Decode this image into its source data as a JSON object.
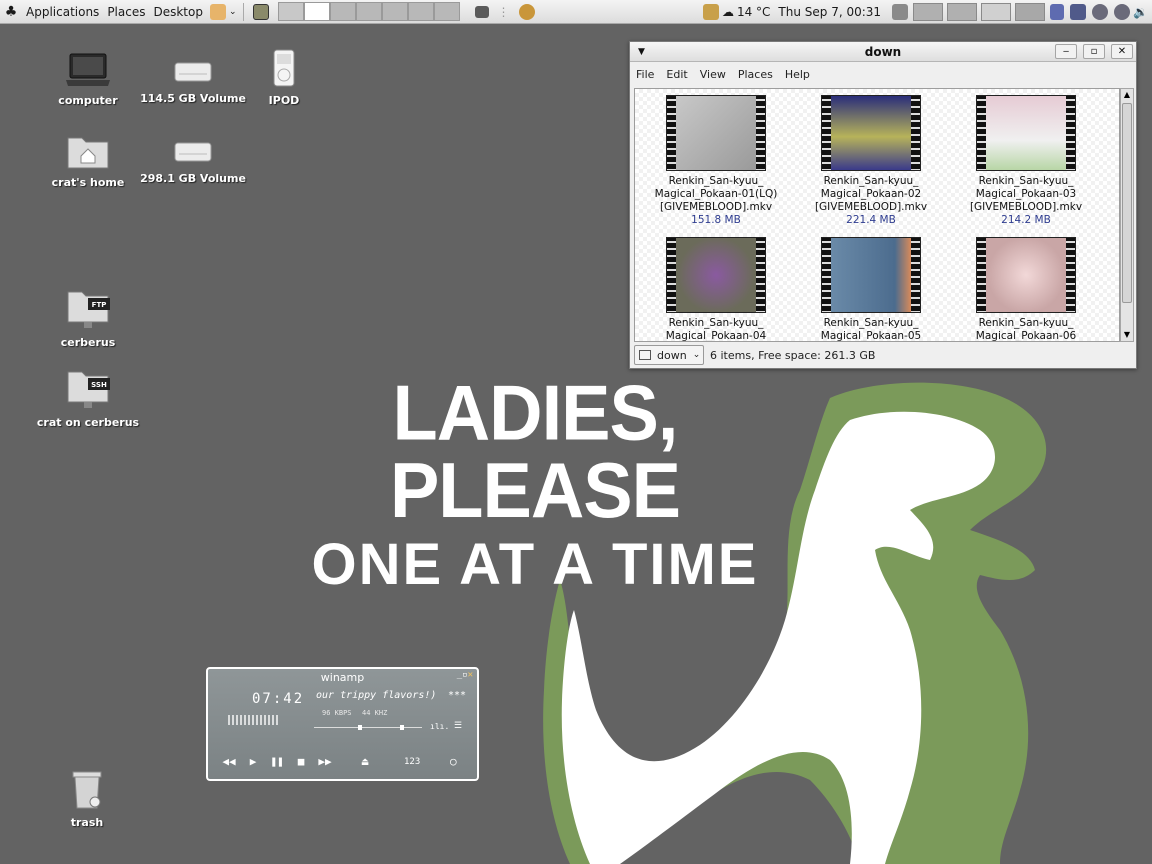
{
  "panel": {
    "menus": [
      "Applications",
      "Places",
      "Desktop"
    ],
    "weather": "14 °C",
    "clock": "Thu Sep  7, 00:31"
  },
  "wallpaper": {
    "line1": "LADIES, PLEASE",
    "line2": "ONE AT A TIME"
  },
  "desktop_icons": [
    {
      "label": "computer"
    },
    {
      "label": "114.5 GB Volume"
    },
    {
      "label": "IPOD"
    },
    {
      "label": "crat's home"
    },
    {
      "label": "298.1 GB Volume"
    },
    {
      "label": "cerberus",
      "badge": "FTP"
    },
    {
      "label": "crat on cerberus",
      "badge": "SSH"
    },
    {
      "label": "trash"
    }
  ],
  "file_manager": {
    "title": "down",
    "menu": [
      "File",
      "Edit",
      "View",
      "Places",
      "Help"
    ],
    "files": [
      {
        "name1": "Renkin_San-kyuu_",
        "name2": "Magical_Pokaan-01(LQ)",
        "name3": "[GIVEMEBLOOD].mkv",
        "size": "151.8 MB"
      },
      {
        "name1": "Renkin_San-kyuu_",
        "name2": "Magical_Pokaan-02",
        "name3": "[GIVEMEBLOOD].mkv",
        "size": "221.4 MB"
      },
      {
        "name1": "Renkin_San-kyuu_",
        "name2": "Magical_Pokaan-03",
        "name3": "[GIVEMEBLOOD].mkv",
        "size": "214.2 MB"
      },
      {
        "name1": "Renkin_San-kyuu_",
        "name2": "Magical_Pokaan-04"
      },
      {
        "name1": "Renkin_San-kyuu_",
        "name2": "Magical_Pokaan-05"
      },
      {
        "name1": "Renkin_San-kyuu_",
        "name2": "Magical_Pokaan-06"
      }
    ],
    "location": "down",
    "status": "6 items, Free space: 261.3 GB"
  },
  "winamp": {
    "title": "winamp",
    "time": "07:42",
    "song": "our trippy flavors!)",
    "stars": "***",
    "kbps": "96 KBPS",
    "khz": "44 KHZ",
    "counter": "123"
  }
}
